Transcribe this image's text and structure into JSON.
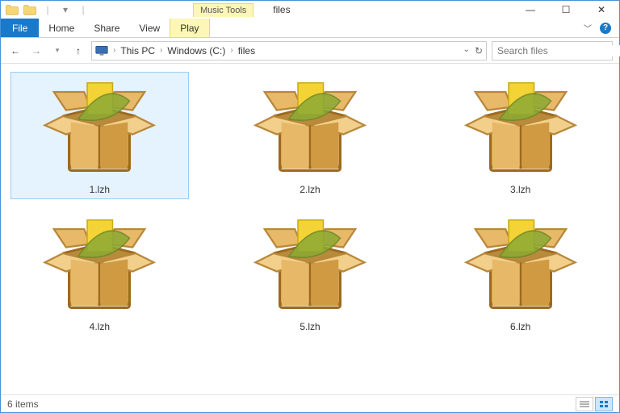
{
  "window": {
    "title": "files",
    "tool_context_label": "Music Tools"
  },
  "ribbon": {
    "file": "File",
    "home": "Home",
    "share": "Share",
    "view": "View",
    "play": "Play"
  },
  "breadcrumb": {
    "items": [
      "This PC",
      "Windows (C:)",
      "files"
    ]
  },
  "search": {
    "placeholder": "Search files"
  },
  "files": [
    {
      "name": "1.lzh",
      "selected": true
    },
    {
      "name": "2.lzh",
      "selected": false
    },
    {
      "name": "3.lzh",
      "selected": false
    },
    {
      "name": "4.lzh",
      "selected": false
    },
    {
      "name": "5.lzh",
      "selected": false
    },
    {
      "name": "6.lzh",
      "selected": false
    }
  ],
  "status": {
    "item_count": "6 items"
  }
}
